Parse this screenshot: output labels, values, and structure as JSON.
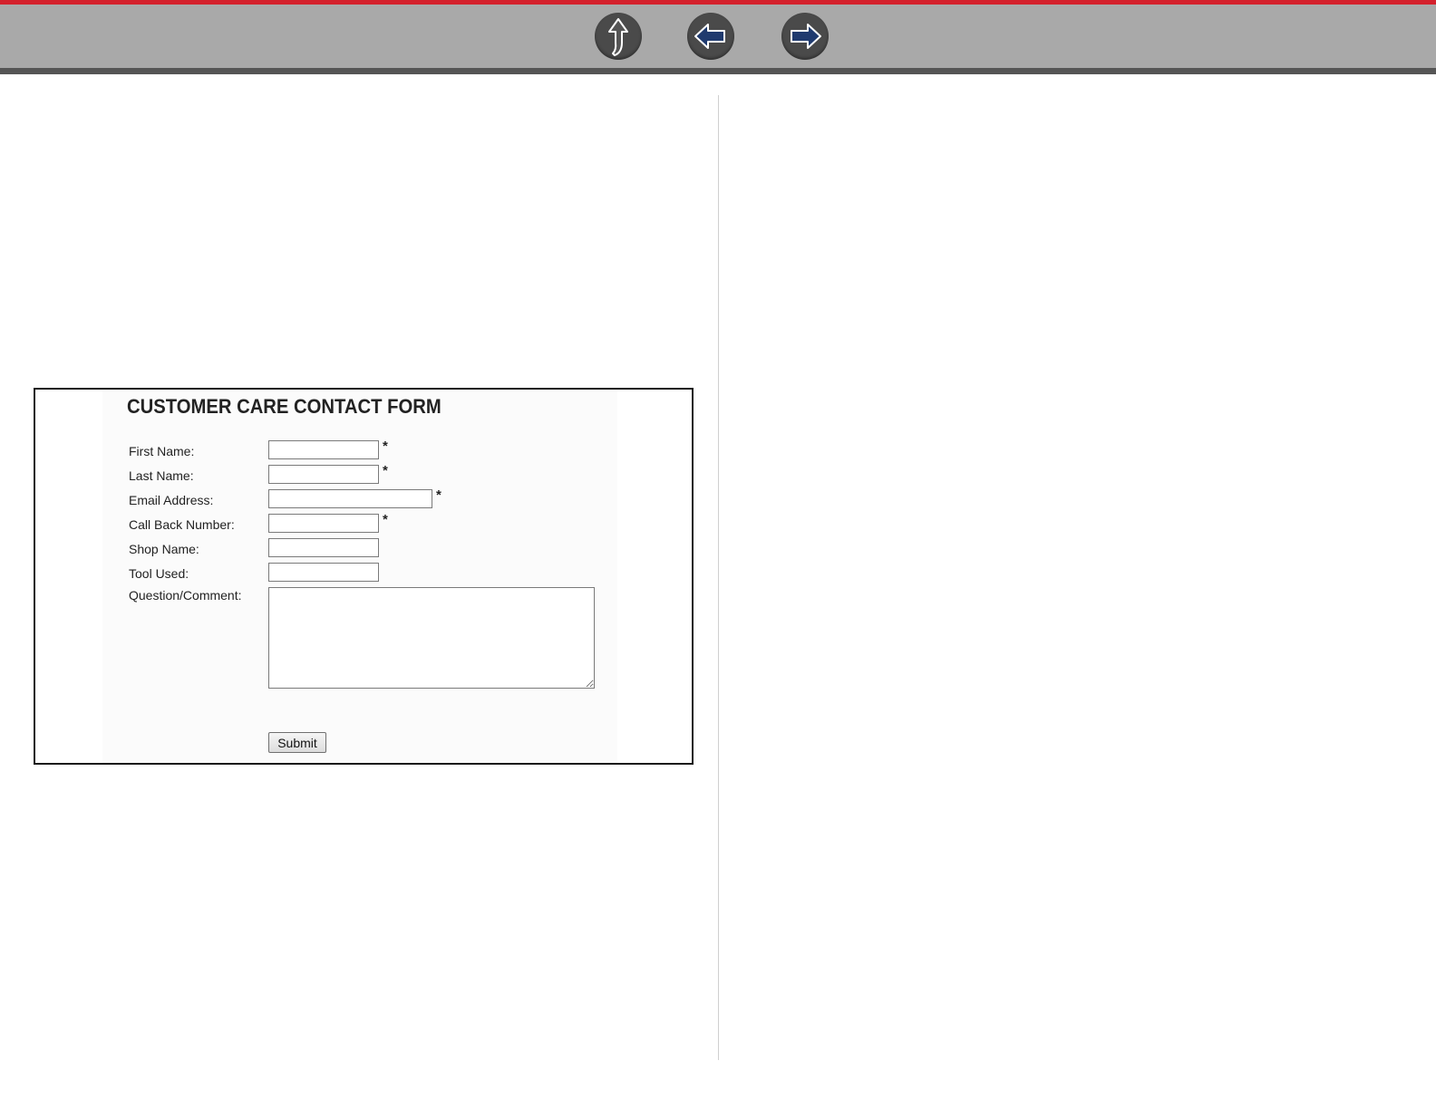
{
  "toolbar": {
    "colors": {
      "bar": "#a9a9a9",
      "stripe": "#d4202c",
      "button": "#4a4a4a",
      "arrow_back_fwd": "#1f3a6e",
      "arrow_up": "#555555"
    },
    "buttons": [
      {
        "icon": "up-arrow-icon"
      },
      {
        "icon": "back-arrow-icon"
      },
      {
        "icon": "forward-arrow-icon"
      }
    ]
  },
  "form": {
    "title": "CUSTOMER CARE CONTACT FORM",
    "fields": {
      "first_name": {
        "label": "First Name:",
        "value": "",
        "required_mark": "*"
      },
      "last_name": {
        "label": "Last Name:",
        "value": "",
        "required_mark": "*"
      },
      "email": {
        "label": "Email Address:",
        "value": "",
        "required_mark": "*"
      },
      "call_back": {
        "label": "Call Back Number:",
        "value": "",
        "required_mark": "*"
      },
      "shop_name": {
        "label": "Shop Name:",
        "value": ""
      },
      "tool_used": {
        "label": "Tool Used:",
        "value": ""
      },
      "comment": {
        "label": "Question/Comment:",
        "value": ""
      }
    },
    "submit_label": "Submit"
  }
}
